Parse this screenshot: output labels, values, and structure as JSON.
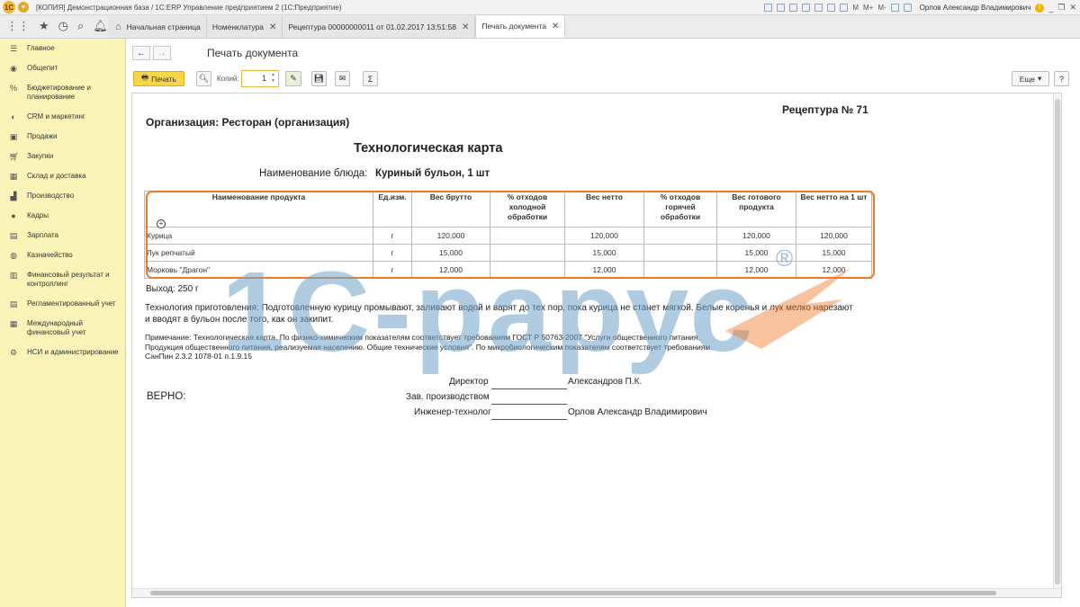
{
  "titlebar": {
    "logo": "1С",
    "title": "[КОПИЯ] Демонстрационная база / 1С:ERP Управление предприятием 2  (1С:Предприятие)",
    "right_labels": [
      "M",
      "M+",
      "M-"
    ],
    "user": "Орлов Александр Владимирович",
    "info_icon": "i"
  },
  "tabs": [
    {
      "label": "Начальная страница",
      "closable": false
    },
    {
      "label": "Номенклатура",
      "closable": true
    },
    {
      "label": "Рецептура 00000000011 от 01.02.2017 13:51:58",
      "closable": true
    },
    {
      "label": "Печать документа",
      "closable": true,
      "active": true
    }
  ],
  "sidebar": {
    "items": [
      {
        "label": "Главное",
        "icon": "menu-icon"
      },
      {
        "label": "Общепит",
        "icon": "food-icon"
      },
      {
        "label": "Бюджетирование и планирование",
        "icon": "budget-icon"
      },
      {
        "label": "CRM и маркетинг",
        "icon": "crm-icon"
      },
      {
        "label": "Продажи",
        "icon": "sales-icon"
      },
      {
        "label": "Закупки",
        "icon": "purchase-icon"
      },
      {
        "label": "Склад и доставка",
        "icon": "warehouse-icon"
      },
      {
        "label": "Производство",
        "icon": "factory-icon"
      },
      {
        "label": "Кадры",
        "icon": "people-icon"
      },
      {
        "label": "Зарплата",
        "icon": "salary-icon"
      },
      {
        "label": "Казначейство",
        "icon": "treasury-icon"
      },
      {
        "label": "Финансовый результат и контроллинг",
        "icon": "finance-icon"
      },
      {
        "label": "Регламентированный учет",
        "icon": "accounting-icon"
      },
      {
        "label": "Международный финансовый учет",
        "icon": "intl-finance-icon"
      },
      {
        "label": "НСИ и администрирование",
        "icon": "gear-icon"
      }
    ]
  },
  "page": {
    "title": "Печать документа",
    "print_label": "Печать",
    "copies_label": "Копий:",
    "copies_value": "1",
    "more_label": "Еще",
    "help_label": "?"
  },
  "document": {
    "recept_no": "Рецептура № 71",
    "org": "Организация: Ресторан (организация)",
    "title": "Технологическая карта",
    "dish_label": "Наименование блюда:",
    "dish_value": "Куриный бульон, 1 шт",
    "headers": [
      "Наименование продукта",
      "Ед.изм.",
      "Вес брутто",
      "% отходов холодной обработки",
      "Вес нетто",
      "% отходов горячей обработки",
      "Вес готового продукта",
      "Вес нетто на  1 шт"
    ],
    "rows": [
      [
        "Курица",
        "г",
        "120,000",
        "",
        "120,000",
        "",
        "120,000",
        "120,000"
      ],
      [
        "Лук репчатый",
        "г",
        "15,000",
        "",
        "15,000",
        "",
        "15,000",
        "15,000"
      ],
      [
        "Морковь \"Драгон\"",
        "г",
        "12,000",
        "",
        "12,000",
        "",
        "12,000",
        "12,000"
      ]
    ],
    "yield": "Выход: 250 г",
    "tech": "Технология приготовления: Подготовленную курицу промывают, заливают водой и варят до тех пор, пока курица не станет мягкой. Белые коренья и лук мелко нарезают и вводят в бульон после того, как он закипит.",
    "note": "Примечание: Технологическая карта. По физико-химическим показателям соответствует требованиям ГОСТ Р 50763-2007 \"Услуги общественного питания. Продукция общественного питания, реализуемая населению. Общие технические условия\". По микробиологическим показателям соответствует требованиям СанПин 2.3.2 1078-01 п.1.9.15",
    "signatures": [
      {
        "role": "Директор",
        "name": "Александров П.К."
      },
      {
        "role": "Зав. производством",
        "name": ""
      },
      {
        "role": "Инженер-технолог",
        "name": "Орлов Александр Владимирович"
      }
    ],
    "verno": "ВЕРНО:"
  },
  "watermark": {
    "text": "1С-рарус",
    "registered": "®",
    "color_main": "#6fa3c9",
    "color_accent": "#f07a26"
  },
  "colors": {
    "sidebar_bg": "#faf4b9",
    "print_button": "#f7d748",
    "highlight": "#f07a26"
  }
}
